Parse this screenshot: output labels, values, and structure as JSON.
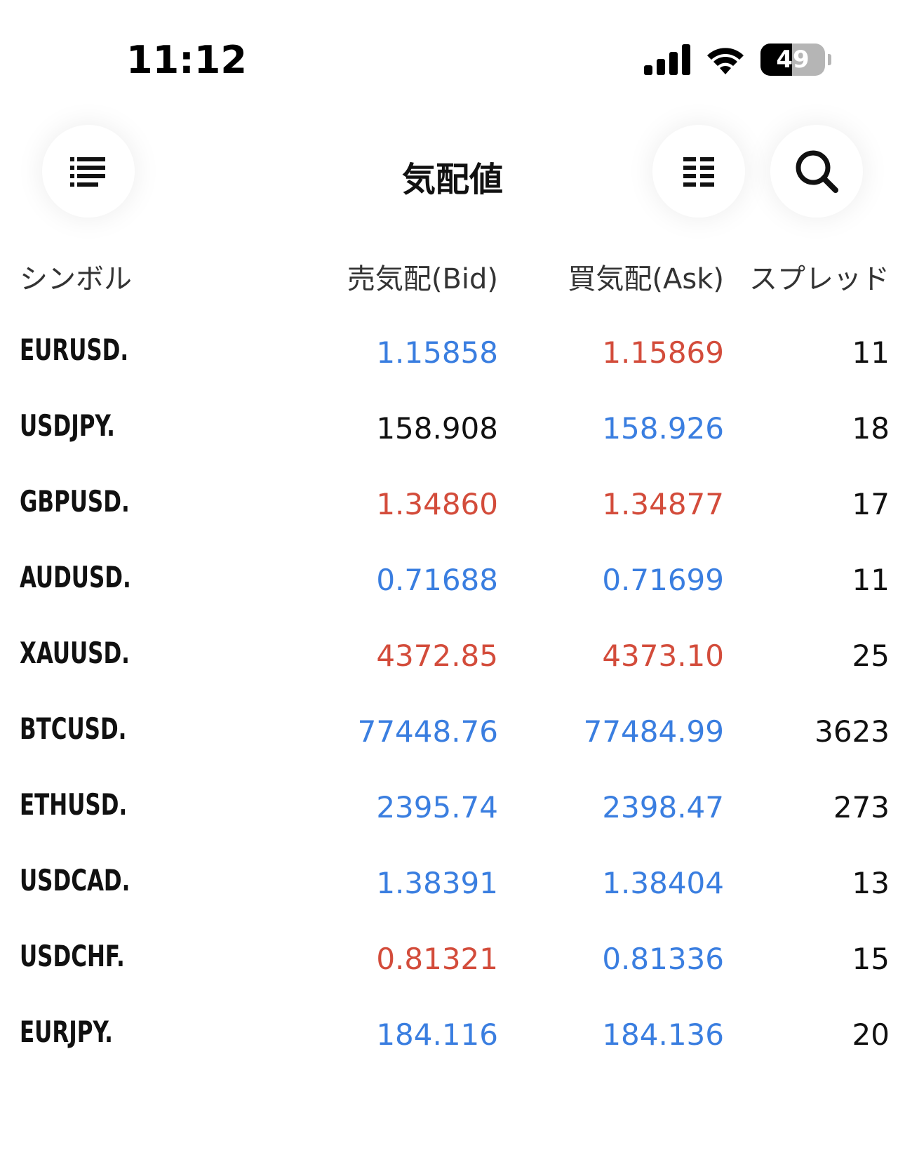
{
  "status_bar": {
    "time": "11:12",
    "battery_percent": "49",
    "battery_level": 0.49
  },
  "header": {
    "title": "気配値",
    "left_icon": "list-icon",
    "columns_icon": "columns-icon",
    "search_icon": "search-icon"
  },
  "columns": {
    "symbol": "シンボル",
    "bid": "売気配(Bid)",
    "ask": "買気配(Ask)",
    "spread": "スプレッド"
  },
  "colors": {
    "up": "#3a7ee0",
    "down": "#d34c3b",
    "neutral": "#111111"
  },
  "rows": [
    {
      "symbol": "EURUSD.",
      "bid": "1.15858",
      "bid_dir": "up",
      "ask": "1.15869",
      "ask_dir": "down",
      "spread": "11"
    },
    {
      "symbol": "USDJPY.",
      "bid": "158.908",
      "bid_dir": "neutral",
      "ask": "158.926",
      "ask_dir": "up",
      "spread": "18"
    },
    {
      "symbol": "GBPUSD.",
      "bid": "1.34860",
      "bid_dir": "down",
      "ask": "1.34877",
      "ask_dir": "down",
      "spread": "17"
    },
    {
      "symbol": "AUDUSD.",
      "bid": "0.71688",
      "bid_dir": "up",
      "ask": "0.71699",
      "ask_dir": "up",
      "spread": "11"
    },
    {
      "symbol": "XAUUSD.",
      "bid": "4372.85",
      "bid_dir": "down",
      "ask": "4373.10",
      "ask_dir": "down",
      "spread": "25"
    },
    {
      "symbol": "BTCUSD.",
      "bid": "77448.76",
      "bid_dir": "up",
      "ask": "77484.99",
      "ask_dir": "up",
      "spread": "3623"
    },
    {
      "symbol": "ETHUSD.",
      "bid": "2395.74",
      "bid_dir": "up",
      "ask": "2398.47",
      "ask_dir": "up",
      "spread": "273"
    },
    {
      "symbol": "USDCAD.",
      "bid": "1.38391",
      "bid_dir": "up",
      "ask": "1.38404",
      "ask_dir": "up",
      "spread": "13"
    },
    {
      "symbol": "USDCHF.",
      "bid": "0.81321",
      "bid_dir": "down",
      "ask": "0.81336",
      "ask_dir": "up",
      "spread": "15"
    },
    {
      "symbol": "EURJPY.",
      "bid": "184.116",
      "bid_dir": "up",
      "ask": "184.136",
      "ask_dir": "up",
      "spread": "20"
    }
  ]
}
